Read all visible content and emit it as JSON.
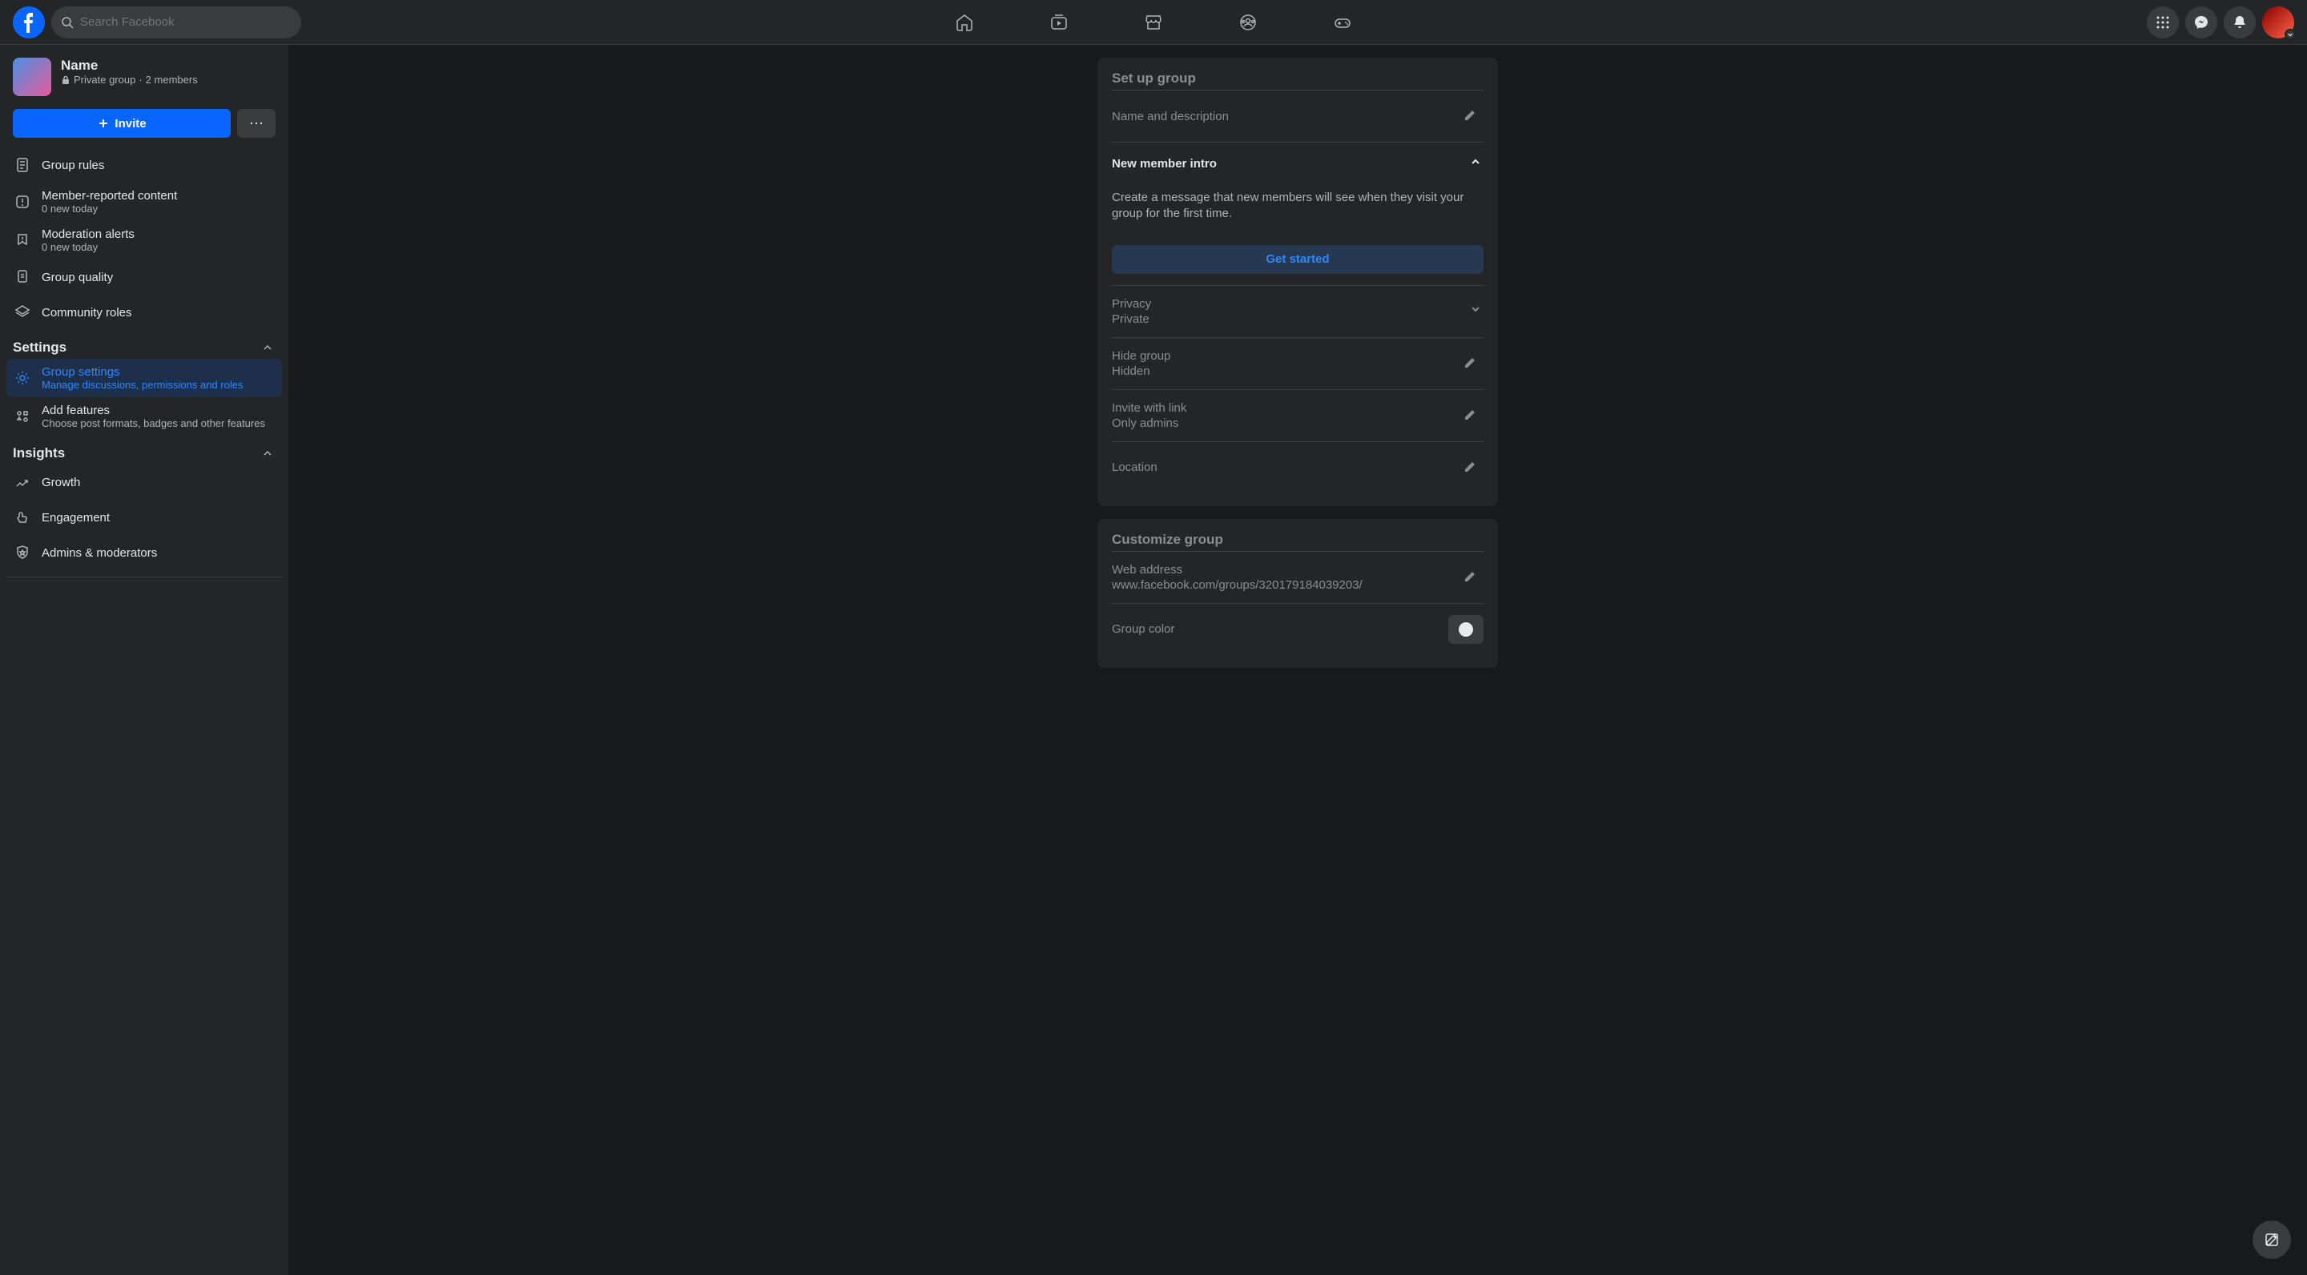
{
  "search": {
    "placeholder": "Search Facebook"
  },
  "group": {
    "name": "Name",
    "privacy": "Private group",
    "members": "2 members",
    "invite_label": "Invite"
  },
  "sidebar": {
    "items": [
      {
        "label": "Group rules"
      },
      {
        "label": "Member-reported content",
        "sub": "0 new today"
      },
      {
        "label": "Moderation alerts",
        "sub": "0 new today"
      },
      {
        "label": "Group quality"
      },
      {
        "label": "Community roles"
      }
    ],
    "settings_header": "Settings",
    "settings": [
      {
        "label": "Group settings",
        "sub": "Manage discussions, permissions and roles"
      },
      {
        "label": "Add features",
        "sub": "Choose post formats, badges and other features"
      }
    ],
    "insights_header": "Insights",
    "insights": [
      {
        "label": "Growth"
      },
      {
        "label": "Engagement"
      },
      {
        "label": "Admins & moderators"
      }
    ]
  },
  "setup": {
    "title": "Set up group",
    "name_desc": "Name and description",
    "new_member": {
      "label": "New member intro",
      "desc": "Create a message that new members will see when they visit your group for the first time.",
      "button": "Get started"
    },
    "privacy": {
      "label": "Privacy",
      "value": "Private"
    },
    "hide": {
      "label": "Hide group",
      "value": "Hidden"
    },
    "invite_link": {
      "label": "Invite with link",
      "value": "Only admins"
    },
    "location": {
      "label": "Location"
    }
  },
  "customize": {
    "title": "Customize group",
    "web": {
      "label": "Web address",
      "value": "www.facebook.com/groups/320179184039203/"
    },
    "color": {
      "label": "Group color"
    }
  }
}
